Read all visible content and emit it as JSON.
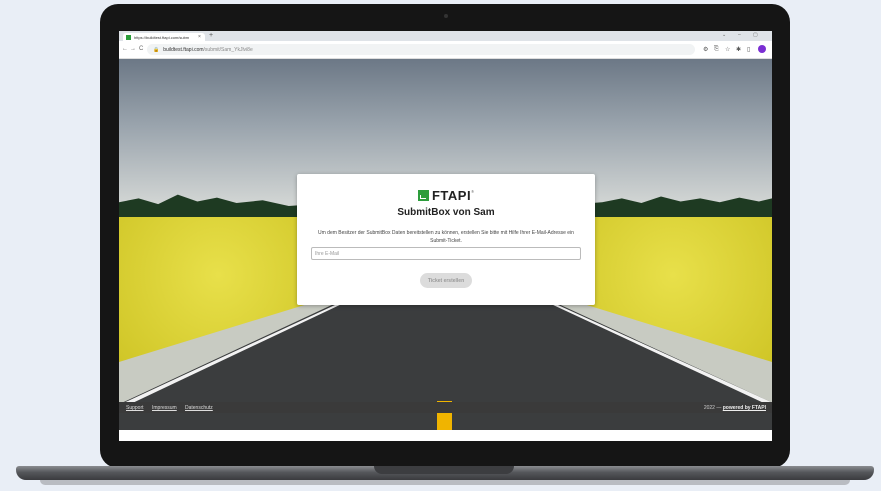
{
  "browser": {
    "tab_title": "https://buildtest.ftapi.com/subm",
    "tab_close": "×",
    "new_tab": "+",
    "window_controls": [
      "⌄",
      "–",
      "▢"
    ],
    "nav": {
      "back": "←",
      "forward": "→",
      "reload": "C"
    },
    "url_host": "buildtest.ftapi.com",
    "url_path": "/submit/Sam_YkJlvi8e",
    "extension_icons": [
      "⚙",
      "⎘",
      "☆",
      "✱",
      "▯"
    ],
    "profile_letter": "C"
  },
  "card": {
    "logo_text": "FTAPI",
    "logo_reg": "®",
    "heading": "SubmitBox von Sam",
    "description": "Um dem Besitzer der SubmitBox Daten bereitstellen zu können, erstellen Sie bitte mit Hilfe Ihrer E-Mail-Adresse ein Submit-Ticket.",
    "email_placeholder": "Ihre E-Mail",
    "button_label": "Ticket erstellen"
  },
  "footer": {
    "links": [
      "Support",
      "Impressum",
      "Datenschutz"
    ],
    "copyright": "2022 — ",
    "powered": "powered by FTAPI"
  },
  "colors": {
    "brand_green": "#2d9d3c",
    "profile": "#7b2fd3",
    "road_line": "#f0b400"
  }
}
